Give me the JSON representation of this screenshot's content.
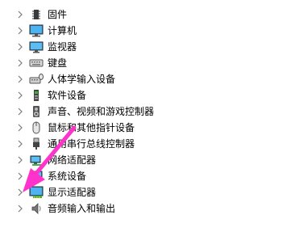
{
  "device_tree": {
    "items": [
      {
        "label": "固件",
        "icon": "firmware-icon"
      },
      {
        "label": "计算机",
        "icon": "computer-icon"
      },
      {
        "label": "监视器",
        "icon": "monitor-icon"
      },
      {
        "label": "键盘",
        "icon": "keyboard-icon"
      },
      {
        "label": "人体学输入设备",
        "icon": "hid-icon"
      },
      {
        "label": "软件设备",
        "icon": "software-device-icon"
      },
      {
        "label": "声音、视频和游戏控制器",
        "icon": "sound-video-icon"
      },
      {
        "label": "鼠标和其他指针设备",
        "icon": "mouse-icon"
      },
      {
        "label": "通用串行总线控制器",
        "icon": "usb-icon"
      },
      {
        "label": "网络适配器",
        "icon": "network-adapter-icon"
      },
      {
        "label": "系统设备",
        "icon": "system-device-icon"
      },
      {
        "label": "显示适配器",
        "icon": "display-adapter-icon"
      },
      {
        "label": "音频输入和输出",
        "icon": "audio-io-icon"
      }
    ]
  },
  "annotation": {
    "color": "#ff33cc",
    "icon": "pointer-arrow-icon"
  }
}
